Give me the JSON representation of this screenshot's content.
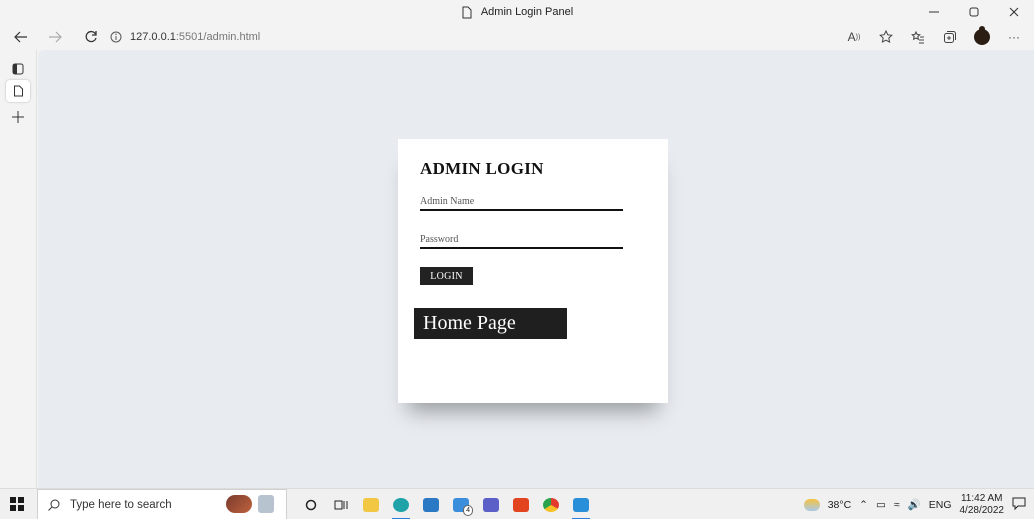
{
  "window": {
    "title": "Admin Login Panel"
  },
  "browser": {
    "url_host": "127.0.0.1",
    "url_path": ":5501/admin.html"
  },
  "page": {
    "login_title": "ADMIN LOGIN",
    "admin_name_placeholder": "Admin Name",
    "password_placeholder": "Password",
    "login_button": "LOGIN",
    "home_button": "Home Page"
  },
  "taskbar": {
    "search_placeholder": "Type here to search",
    "weather": "38°C",
    "language": "ENG",
    "time": "11:42 AM",
    "date": "4/28/2022",
    "mail_badge": "4"
  },
  "colors": {
    "page_background": "#e8ecf1",
    "card_background": "#ffffff",
    "button_background": "#1f1f1f",
    "taskbar_accent": "#2f7bd6"
  }
}
